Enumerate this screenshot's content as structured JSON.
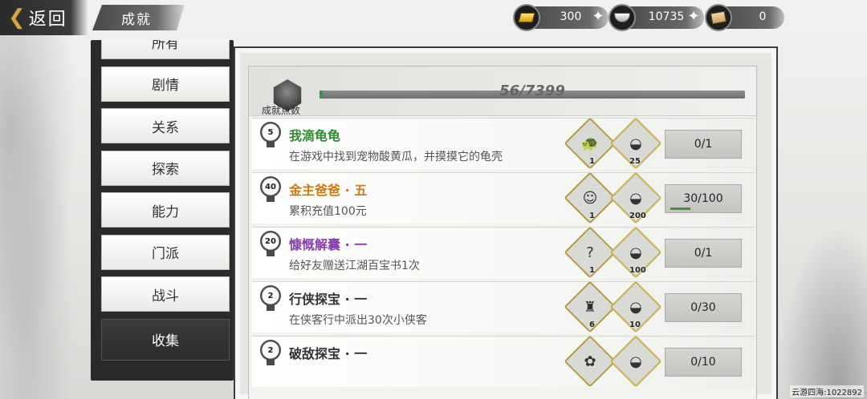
{
  "header": {
    "back_label": "返回",
    "title": "成就",
    "currencies": [
      {
        "icon": "gold-bar-icon",
        "value": "300"
      },
      {
        "icon": "silver-ingot-icon",
        "value": "10735"
      },
      {
        "icon": "scroll-icon",
        "value": "0"
      }
    ]
  },
  "sidebar": {
    "items": [
      {
        "label": "所有"
      },
      {
        "label": "剧情"
      },
      {
        "label": "关系"
      },
      {
        "label": "探索"
      },
      {
        "label": "能力"
      },
      {
        "label": "门派"
      },
      {
        "label": "战斗"
      },
      {
        "label": "收集",
        "active": true
      }
    ]
  },
  "progress": {
    "label": "成就点数",
    "text": "56/7399",
    "current": 56,
    "total": 7399
  },
  "achievements": [
    {
      "level": "5",
      "title": "我滴龟龟",
      "title_color": "#2f8f2f",
      "desc": "在游戏中找到宠物酸黄瓜，并摸摸它的龟壳",
      "reward1_icon": "turtle-pet-icon",
      "reward1_count": "1",
      "reward2_icon": "silver-ingot-icon",
      "reward2_count": "25",
      "status": "0/1",
      "progress": 0
    },
    {
      "level": "40",
      "title": "金主爸爸 · 五",
      "title_color": "#d07a10",
      "desc": "累积充值100元",
      "reward1_icon": "character-portrait-icon",
      "reward1_count": "1",
      "reward2_icon": "silver-ingot-icon",
      "reward2_count": "200",
      "status": "30/100",
      "progress": 0.3
    },
    {
      "level": "20",
      "title": "慷慨解囊 · 一",
      "title_color": "#8a3fb0",
      "desc": "给好友赠送江湖百宝书1次",
      "reward1_icon": "mystery-question-icon",
      "reward1_count": "1",
      "reward2_icon": "silver-ingot-icon",
      "reward2_count": "100",
      "status": "0/1",
      "progress": 0
    },
    {
      "level": "2",
      "title": "行侠探宝 · 一",
      "title_color": "#333333",
      "desc": "在侠客行中派出30次小侠客",
      "reward1_icon": "warrior-portrait-icon",
      "reward1_count": "6",
      "reward2_icon": "silver-ingot-icon",
      "reward2_count": "10",
      "status": "0/30",
      "progress": 0
    },
    {
      "level": "2",
      "title": "破敌探宝 · 一",
      "title_color": "#333333",
      "desc": "",
      "reward1_icon": "pink-token-icon",
      "reward1_count": "",
      "reward2_icon": "silver-ingot-icon",
      "reward2_count": "",
      "status": "0/10",
      "progress": 0
    }
  ],
  "footer": {
    "id_text": "云游四海:1022892"
  }
}
